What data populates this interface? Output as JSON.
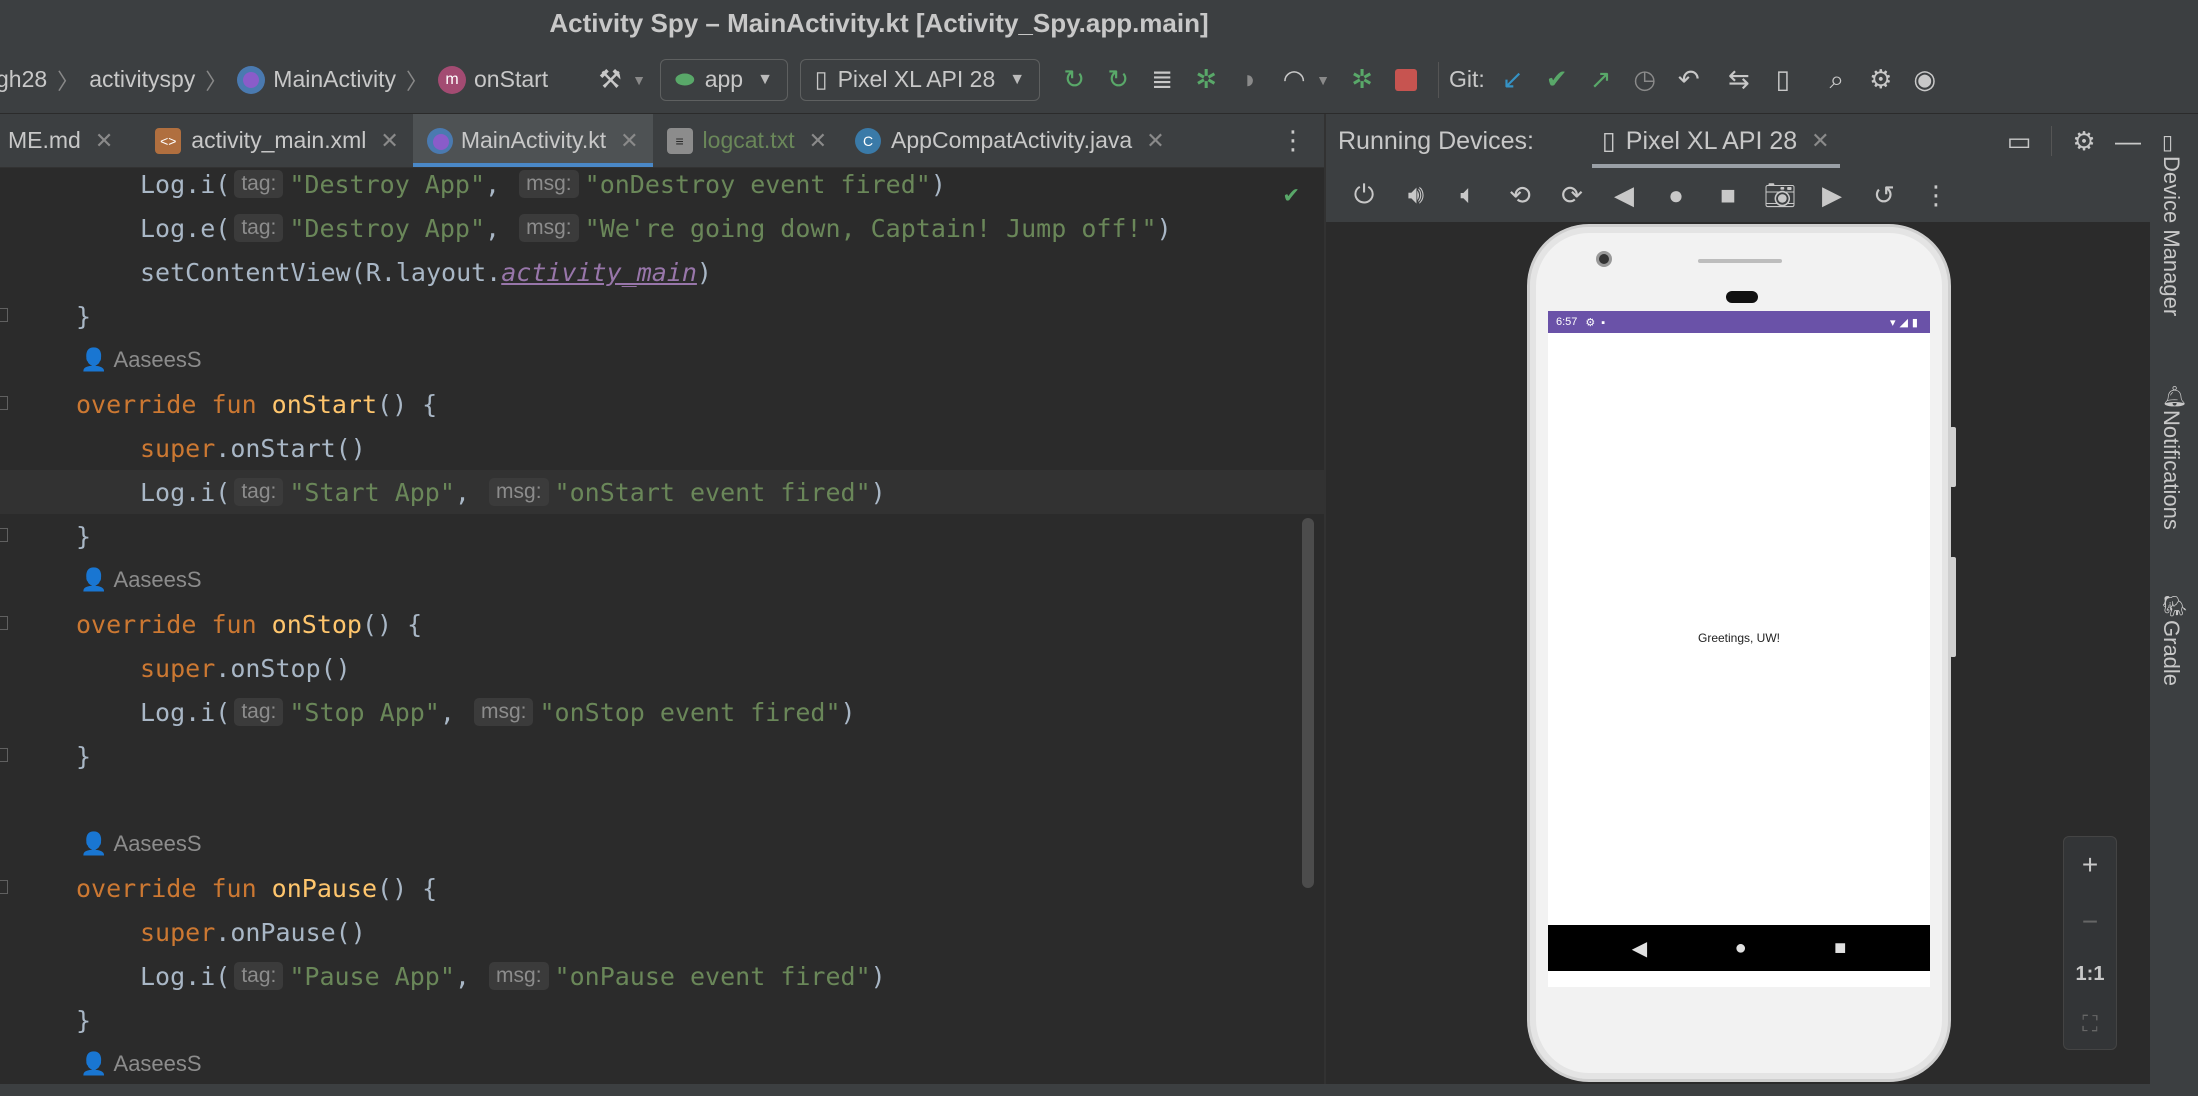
{
  "window": {
    "title": "Activity Spy – MainActivity.kt [Activity_Spy.app.main]"
  },
  "breadcrumb": {
    "items": [
      "gh28",
      "activityspy",
      "MainActivity",
      "onStart"
    ]
  },
  "toolbar": {
    "run_config": "app",
    "device": "Pixel XL API 28",
    "git_label": "Git:"
  },
  "tabs": [
    {
      "label": "ME.md",
      "active": false
    },
    {
      "label": "activity_main.xml",
      "active": false
    },
    {
      "label": "MainActivity.kt",
      "active": true
    },
    {
      "label": "logcat.txt",
      "active": false
    },
    {
      "label": "AppCompatActivity.java",
      "active": false
    }
  ],
  "editor": {
    "hints": {
      "tag": "tag:",
      "msg": "msg:"
    },
    "lines": {
      "l1_tag": "\"Destroy App\"",
      "l1_msg": "\"onDestroy event fired\"",
      "l2_tag": "\"Destroy App\"",
      "l2_msg": "\"We're going down, Captain! Jump off!\"",
      "l3_code": "setContentView(R.layout.",
      "l3_res": "activity_main",
      "author": "AaseesS",
      "start_fn": "onStart",
      "start_tag": "\"Start App\"",
      "start_msg": "\"onStart event fired\"",
      "stop_fn": "onStop",
      "stop_tag": "\"Stop App\"",
      "stop_msg": "\"onStop event fired\"",
      "pause_fn": "onPause",
      "pause_tag": "\"Pause App\"",
      "pause_msg": "\"onPause event fired\""
    }
  },
  "running_devices": {
    "title": "Running Devices:",
    "device_tab": "Pixel XL API 28",
    "phone": {
      "time": "6:57",
      "greeting": "Greetings, UW!"
    },
    "zoom": {
      "plus": "+",
      "minus": "−",
      "one_to_one": "1:1"
    }
  },
  "side_tools": [
    "Device Manager",
    "Notifications",
    "Gradle"
  ],
  "colors": {
    "accent": "#4a88c7",
    "status_bar": "#6a52a8",
    "keyword": "#cc7832",
    "string": "#6a8759",
    "function": "#ffc66d"
  }
}
